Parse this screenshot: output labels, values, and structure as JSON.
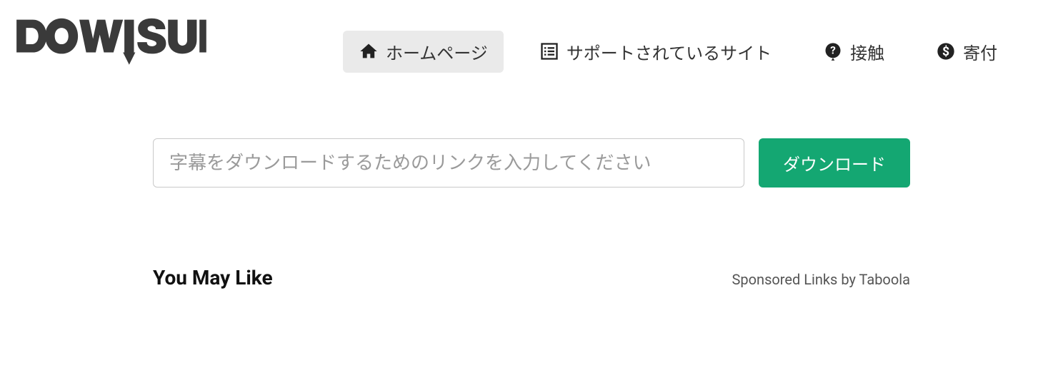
{
  "logo_text": "DOWNSUB",
  "nav": {
    "home": "ホームページ",
    "supported": "サポートされているサイト",
    "contact": "接触",
    "donate": "寄付"
  },
  "input": {
    "placeholder": "字幕をダウンロードするためのリンクを入力してください"
  },
  "download_label": "ダウンロード",
  "section": {
    "you_may_like": "You May Like",
    "sponsored": "Sponsored Links by Taboola"
  }
}
